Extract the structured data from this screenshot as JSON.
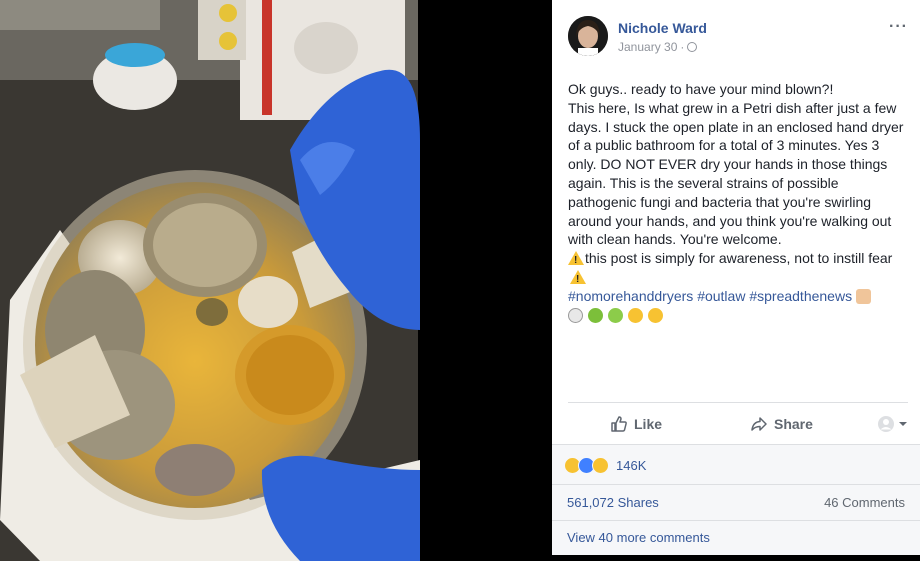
{
  "post": {
    "author": "Nichole Ward",
    "date": "January 30",
    "separator": "·",
    "more_label": "···",
    "body_lines": {
      "line1": "Ok guys.. ready to have your mind blown?!",
      "line2": "This here, Is what grew in a Petri dish after just a few days. I stuck the open plate in an enclosed hand dryer of a public bathroom for a total of 3 minutes. Yes 3 only. DO NOT EVER dry your hands in those things again. This is the several strains of possible pathogenic fungi and bacteria that you're swirling around your hands, and you think you're walking out with clean hands. You're welcome.",
      "line3": "this post is simply for awareness, not to instill fear"
    },
    "hashtags": [
      "#nomorehanddryers",
      "#outlaw",
      "#spreadthenews"
    ],
    "emoji_row": [
      "skull-crossbones",
      "nauseated-face",
      "face-vomiting",
      "mask-face",
      "confounded-face"
    ]
  },
  "actions": {
    "like_label": "Like",
    "share_label": "Share"
  },
  "reactions": {
    "icons": [
      "wow",
      "like",
      "sad"
    ],
    "count": "146K"
  },
  "stats": {
    "shares": "561,072 Shares",
    "comments": "46 Comments"
  },
  "view_more": "View 40 more comments",
  "colors": {
    "link": "#365899",
    "muted": "#90949c",
    "glove": "#2f63d6",
    "divider": "#dddfe2"
  }
}
